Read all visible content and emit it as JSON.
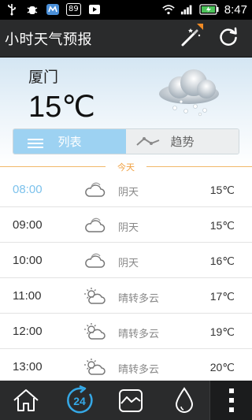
{
  "status_bar": {
    "badge": "89",
    "time": "8:47"
  },
  "app": {
    "title": "小时天气预报"
  },
  "current": {
    "city": "厦门",
    "temperature": "15℃"
  },
  "tabs": {
    "list_label": "列表",
    "trend_label": "趋势",
    "selected": "列表"
  },
  "today_label": "今天",
  "hours": [
    {
      "time": "08:00",
      "condition": "阴天",
      "temp": "15℃",
      "icon": "cloudy-icon",
      "current": true
    },
    {
      "time": "09:00",
      "condition": "阴天",
      "temp": "15℃",
      "icon": "cloudy-icon",
      "current": false
    },
    {
      "time": "10:00",
      "condition": "阴天",
      "temp": "16℃",
      "icon": "cloudy-icon",
      "current": false
    },
    {
      "time": "11:00",
      "condition": "晴转多云",
      "temp": "17℃",
      "icon": "partly-sunny-icon",
      "current": false
    },
    {
      "time": "12:00",
      "condition": "晴转多云",
      "temp": "19℃",
      "icon": "partly-sunny-icon",
      "current": false
    },
    {
      "time": "13:00",
      "condition": "晴转多云",
      "temp": "20℃",
      "icon": "partly-sunny-icon",
      "current": false
    }
  ],
  "bottom_nav": {
    "hours_badge": "24"
  },
  "colors": {
    "accent_blue": "#9dd2f2",
    "current_time": "#7dc2ec",
    "today_orange": "#f0a040",
    "bar_dark": "#2a2b2c"
  }
}
